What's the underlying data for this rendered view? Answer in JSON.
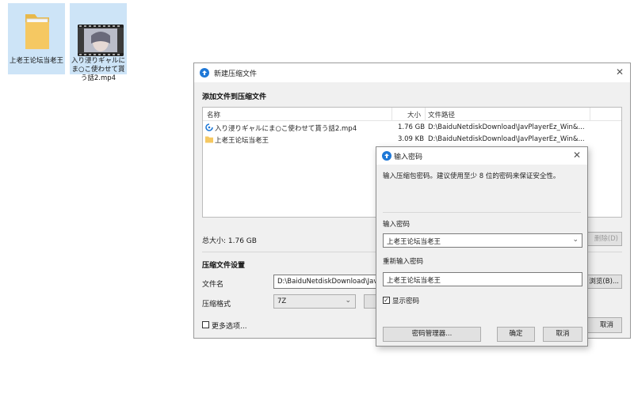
{
  "desktop": {
    "icons": [
      {
        "label": "上老王论坛当老王",
        "icon": "folder-icon"
      },
      {
        "label": "入り浸りギャルにま○こ使わせて貰う話2.mp4",
        "icon": "video-file-icon"
      }
    ]
  },
  "main_dialog": {
    "title": "新建压缩文件",
    "add_files_heading": "添加文件到压缩文件",
    "columns": {
      "name": "名称",
      "size": "大小",
      "path": "文件路径"
    },
    "files": [
      {
        "name": "入り浸りギャルにま○こ使わせて貰う話2.mp4",
        "size": "1.76 GB",
        "path": "D:\\BaiduNetdiskDownload\\JavPlayerEz_Win&...",
        "icon": "media-file-icon"
      },
      {
        "name": "上老王论坛当老王",
        "size": "3.09 KB",
        "path": "D:\\BaiduNetdiskDownload\\JavPlayerEz_Win&...",
        "icon": "folder-icon"
      }
    ],
    "total_size": "总大小: 1.76 GB",
    "delete_button": "删除(D)",
    "settings_heading": "压缩文件设置",
    "filename_label": "文件名",
    "filename_value": "D:\\BaiduNetdiskDownload\\JavPlayer",
    "browse_button": "浏览(B)...",
    "format_label": "压缩格式",
    "format_value": "7Z",
    "more_options": "更多选项...",
    "cancel_button": "取消"
  },
  "password_dialog": {
    "title": "输入密码",
    "message": "输入压缩包密码。建议使用至少 8 位的密码来保证安全性。",
    "password_label": "输入密码",
    "password_value": "上老王论坛当老王",
    "reenter_label": "重新输入密码",
    "reenter_value": "上老王论坛当老王",
    "show_password_label": "显示密码",
    "show_password_checked": true,
    "manager_button": "密码管理器...",
    "ok_button": "确定",
    "cancel_button": "取消"
  },
  "colors": {
    "accent": "#1e78d7",
    "folder": "#f5c862",
    "selection": "#cde4f7"
  }
}
